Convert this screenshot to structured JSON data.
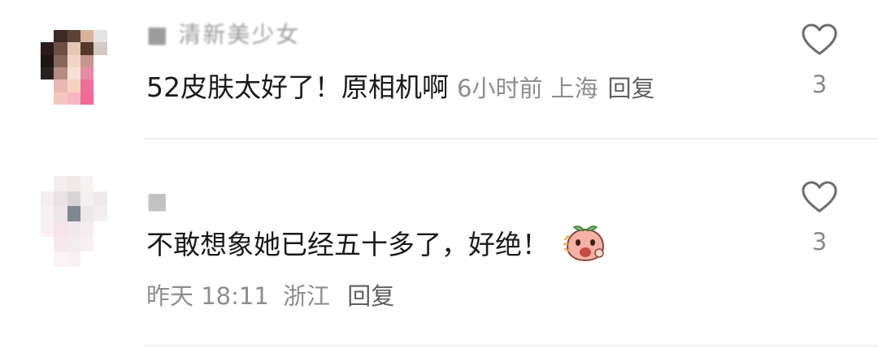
{
  "comments": [
    {
      "username": "■ 清新美少女",
      "text": "52皮肤太好了！原相机啊",
      "time": "6小时前",
      "location": "上海",
      "reply_label": "回复",
      "like_count": "3",
      "liked": false
    },
    {
      "username": "■",
      "text": "不敢想象她已经五十多了，好绝！",
      "emoji": "peach-face-emoji",
      "time": "昨天 18:11",
      "location": "浙江",
      "reply_label": "回复",
      "like_count": "3",
      "liked": false
    }
  ],
  "icons": {
    "like": "heart-outline-icon"
  },
  "colors": {
    "text": "#1a1a1a",
    "meta": "#8e8e8e",
    "reply": "#5f5f5f",
    "divider": "#efefef",
    "heart_stroke": "#6e6e6e"
  }
}
